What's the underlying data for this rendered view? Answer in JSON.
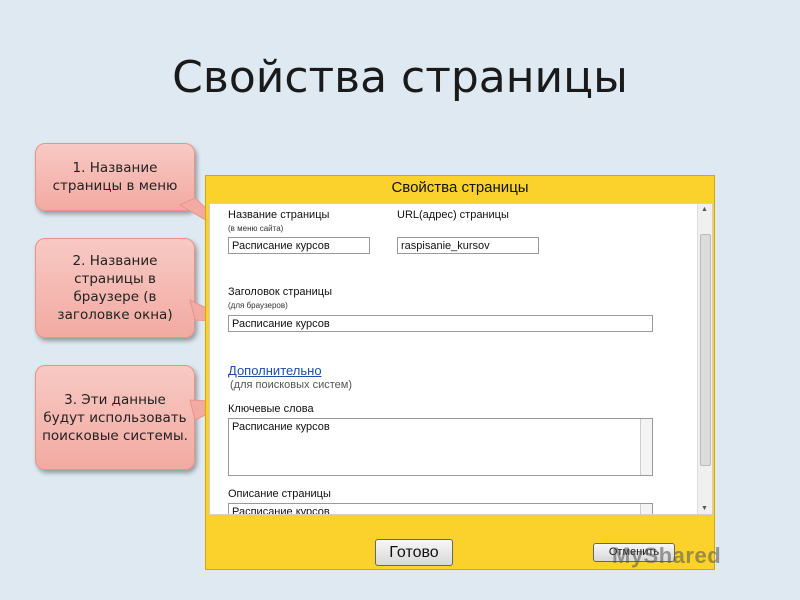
{
  "slide": {
    "title": "Свойства страницы"
  },
  "callouts": [
    {
      "text": "1. Название страницы в меню"
    },
    {
      "text": "2. Название страницы в браузере (в заголовке окна)"
    },
    {
      "text": "3. Эти данные будут использовать поисковые системы."
    }
  ],
  "dialog": {
    "title": "Свойства страницы",
    "page_name_label": "Название страницы",
    "page_name_sub": "(в меню сайта)",
    "page_name_value": "Расписание курсов",
    "url_label": "URL(адрес) страницы",
    "url_value": "raspisanie_kursov",
    "header_label": "Заголовок страницы",
    "header_sub": "(для браузеров)",
    "header_value": "Расписание курсов",
    "advanced_link": "Дополнительно",
    "advanced_hint": "(для поисковых систем)",
    "keywords_label": "Ключевые слова",
    "keywords_value": "Расписание курсов",
    "description_label": "Описание страницы",
    "description_value": "Расписание курсов",
    "done_button": "Готово",
    "cancel_button": "Отменить"
  },
  "watermark": {
    "text": "MyShared"
  },
  "colors": {
    "dialog_bg": "#fbd22b",
    "callout_bg": "#f2aaa2",
    "link": "#1f4ea8"
  }
}
